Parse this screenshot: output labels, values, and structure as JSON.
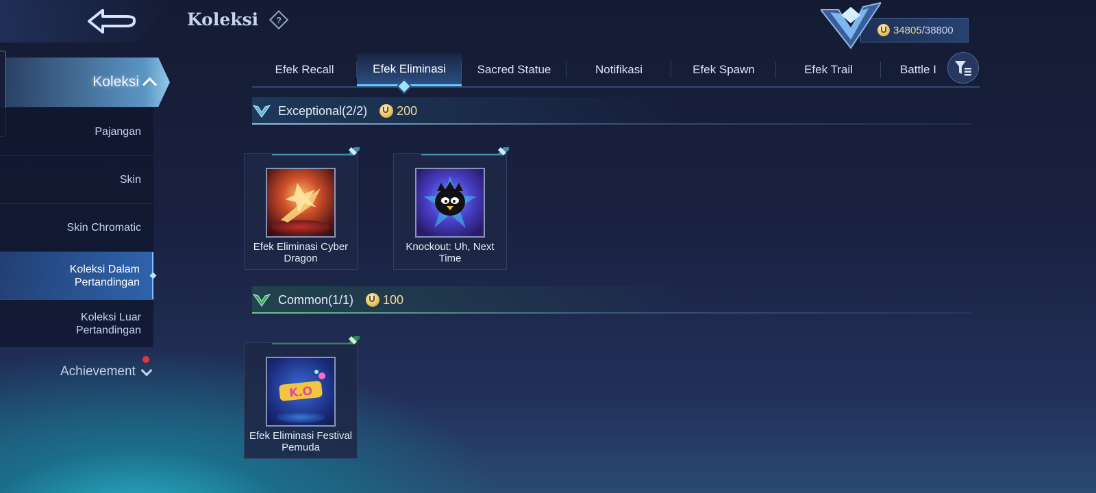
{
  "header": {
    "title": "Koleksi",
    "points_current": "34805",
    "points_separator": "/",
    "points_total": "38800"
  },
  "sidebar": {
    "section_label": "Koleksi",
    "items": [
      {
        "label": "Pajangan",
        "active": false
      },
      {
        "label": "Skin",
        "active": false
      },
      {
        "label": "Skin Chromatic",
        "active": false
      },
      {
        "label": "Koleksi Dalam Pertandingan",
        "active": true
      },
      {
        "label": "Koleksi Luar Pertandingan",
        "active": false
      }
    ],
    "achievement_label": "Achievement"
  },
  "tabs": [
    {
      "label": "Efek Recall",
      "active": false
    },
    {
      "label": "Efek Eliminasi",
      "active": true
    },
    {
      "label": "Sacred Statue",
      "active": false
    },
    {
      "label": "Notifikasi",
      "active": false
    },
    {
      "label": "Efek Spawn",
      "active": false
    },
    {
      "label": "Efek Trail",
      "active": false
    },
    {
      "label": "Battle I",
      "active": false
    }
  ],
  "sections": [
    {
      "title": "Exceptional(2/2)",
      "cost": "200",
      "items": [
        {
          "name": "Efek Eliminasi Cyber Dragon",
          "icon": "cyber-dragon-effect-icon"
        },
        {
          "name": "Knockout: Uh, Next Time",
          "icon": "penguin-knockout-icon"
        }
      ]
    },
    {
      "title": "Common(1/1)",
      "cost": "100",
      "items": [
        {
          "name": "Efek Eliminasi Festival Pemuda",
          "icon": "ko-festival-icon"
        }
      ]
    }
  ],
  "colors": {
    "accent": "#61c7ff",
    "gold": "#f2d99a",
    "exceptional_trim": "#3a8fa8",
    "common_trim": "#2f8a4f"
  }
}
